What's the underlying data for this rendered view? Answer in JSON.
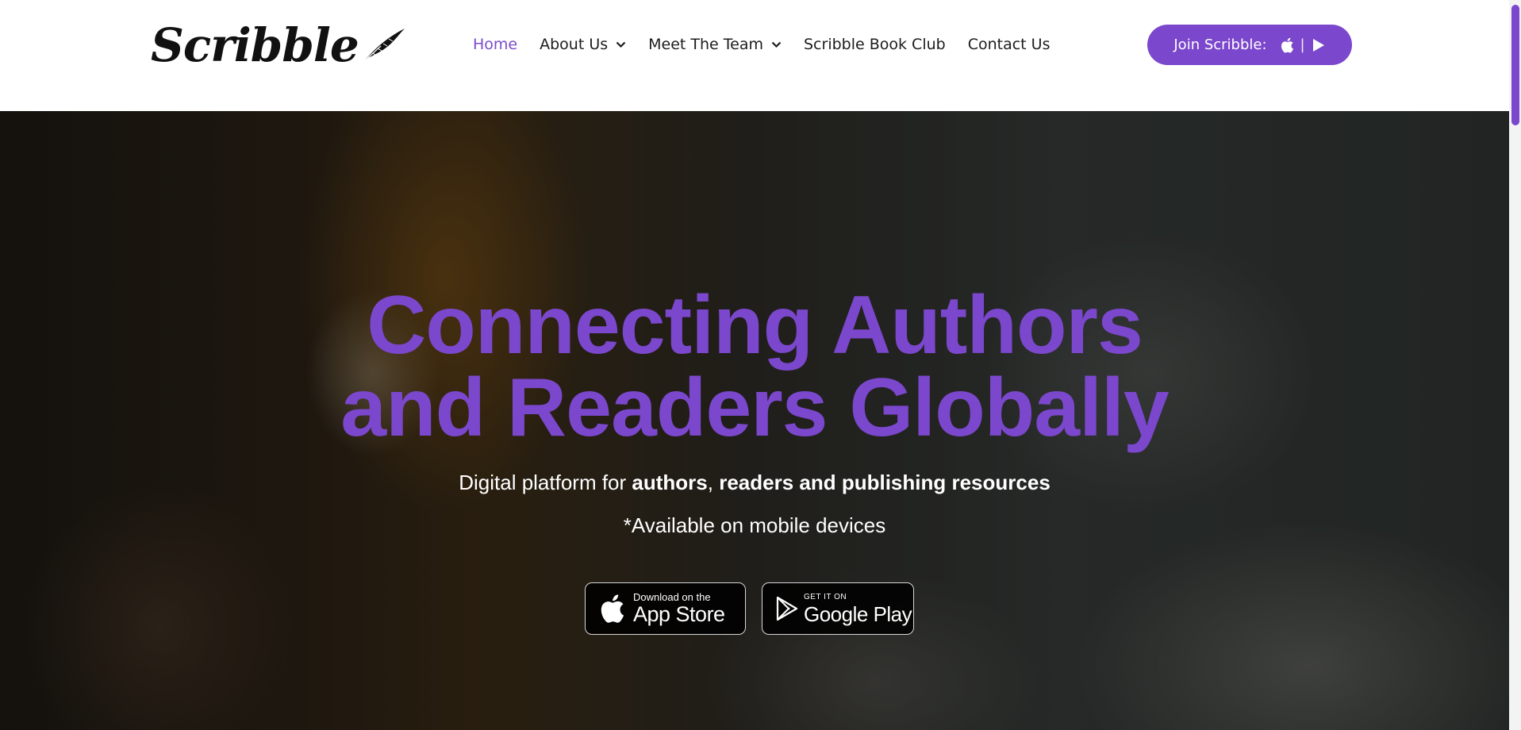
{
  "header": {
    "logo_text": "Scribble",
    "nav": [
      {
        "label": "Home",
        "active": true,
        "dropdown": false
      },
      {
        "label": "About Us",
        "active": false,
        "dropdown": true
      },
      {
        "label": "Meet The Team",
        "active": false,
        "dropdown": true
      },
      {
        "label": "Scribble Book Club",
        "active": false,
        "dropdown": false
      },
      {
        "label": "Contact Us",
        "active": false,
        "dropdown": false
      }
    ],
    "join_label": "Join Scribble:",
    "join_separator": "|"
  },
  "hero": {
    "headline_line1": "Connecting Authors",
    "headline_line2": "and Readers Globally",
    "subtitle_prefix": "Digital platform for ",
    "subtitle_bold1": "authors",
    "subtitle_sep": ", ",
    "subtitle_bold2": "readers and publishing resources",
    "note": "*Available on mobile devices",
    "app_store": {
      "small": "Download on the",
      "big": "App Store"
    },
    "google_play": {
      "small": "GET IT ON",
      "big": "Google Play"
    }
  },
  "colors": {
    "accent": "#7b47cc",
    "nav_active": "#7b4ccc",
    "text_dark": "#1c1c1c"
  },
  "icons": [
    "quill-icon",
    "chevron-down-icon",
    "apple-icon",
    "play-icon",
    "google-play-icon"
  ]
}
